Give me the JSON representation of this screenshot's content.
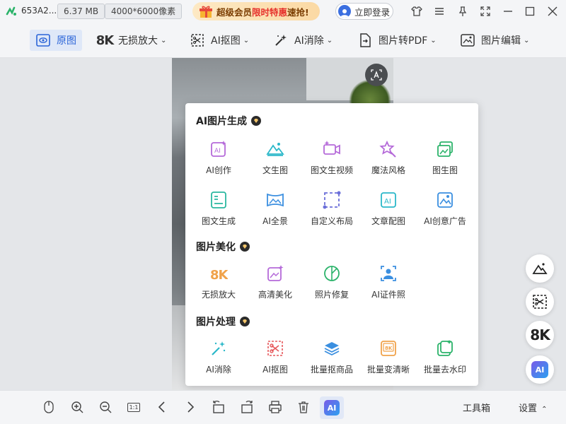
{
  "titlebar": {
    "filename": "653A2...",
    "file_size": "6.37 MB",
    "dimensions": "4000*6000像素",
    "promo_prefix": "超级会员",
    "promo_hot": "限时特惠",
    "promo_suffix": "速抢!",
    "login_label": "立即登录"
  },
  "toolbar": {
    "original": "原图",
    "upscale": "无损放大",
    "cutout": "AI抠图",
    "erase": "AI消除",
    "to_pdf": "图片转PDF",
    "edit": "图片编辑",
    "eightk": "8K"
  },
  "panel": {
    "sections": [
      {
        "title": "AI图片生成",
        "items": [
          "AI创作",
          "文生图",
          "图文生视频",
          "魔法风格",
          "图生图",
          "图文生成",
          "AI全景",
          "自定义布局",
          "文章配图",
          "AI创意广告"
        ]
      },
      {
        "title": "图片美化",
        "items": [
          "无损放大",
          "高清美化",
          "照片修复",
          "AI证件照"
        ]
      },
      {
        "title": "图片处理",
        "items": [
          "AI消除",
          "AI抠图",
          "批量抠商品",
          "批量变清晰",
          "批量去水印"
        ]
      }
    ]
  },
  "bottombar": {
    "ai_label": "AI",
    "toolbox": "工具箱",
    "settings": "设置",
    "fit_label": "1:1"
  },
  "fab": {
    "eightk": "8K",
    "ai": "AI"
  },
  "colors": {
    "accent": "#2a64d8",
    "promo_hot": "#e6302b",
    "purple": "#b56ad9",
    "teal": "#2bb8c9",
    "orange": "#f0a24a"
  }
}
